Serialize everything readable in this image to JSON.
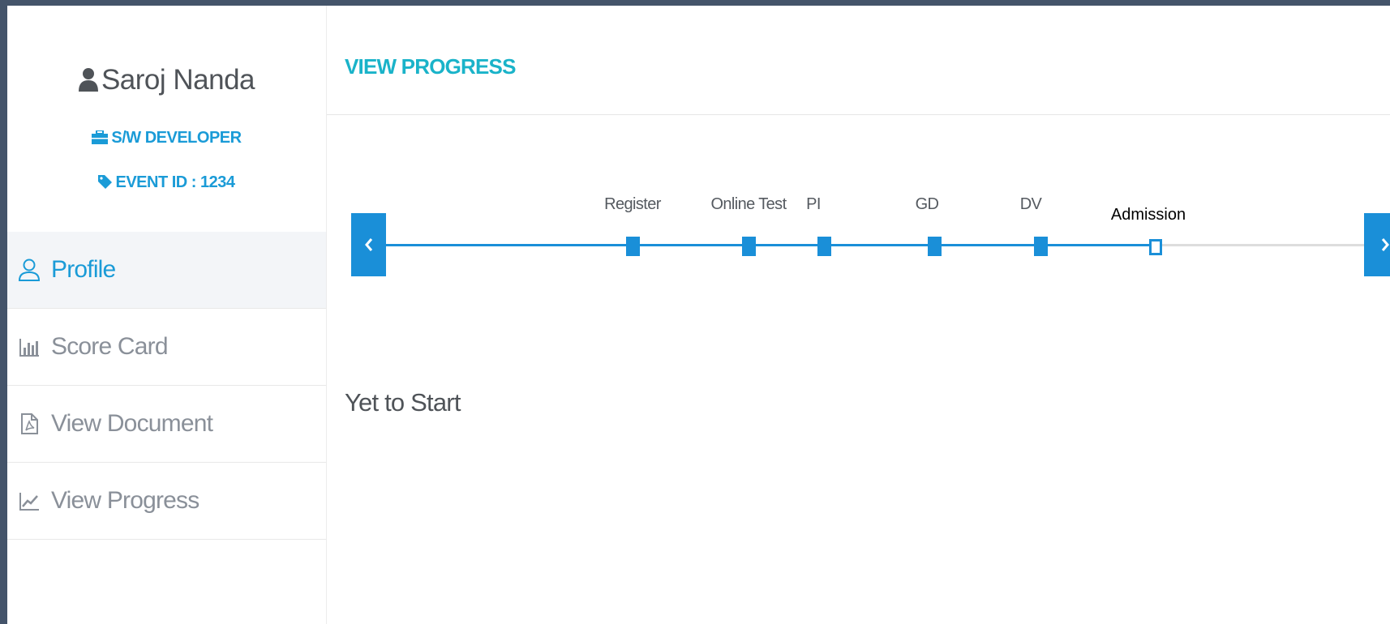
{
  "user": {
    "name": "Saroj Nanda",
    "role": "S/W DEVELOPER",
    "event": "EVENT ID : 1234"
  },
  "sidebar": {
    "items": [
      {
        "label": "Profile",
        "icon": "user-outline-icon",
        "active": true
      },
      {
        "label": "Score Card",
        "icon": "bar-chart-icon",
        "active": false
      },
      {
        "label": "View Document",
        "icon": "pdf-document-icon",
        "active": false
      },
      {
        "label": "View Progress",
        "icon": "line-chart-icon",
        "active": false
      }
    ]
  },
  "main": {
    "title": "VIEW PROGRESS",
    "timeline": {
      "steps": [
        "Register",
        "Online Test",
        "PI",
        "GD",
        "DV",
        "Admission"
      ],
      "current_step": "Admission",
      "prev_icon": "chevron-left-icon",
      "next_icon": "chevron-right-icon"
    },
    "status": "Yet to Start"
  },
  "colors": {
    "accent": "#1a8fd8",
    "title": "#1ab3c9",
    "background": "#44546a"
  }
}
